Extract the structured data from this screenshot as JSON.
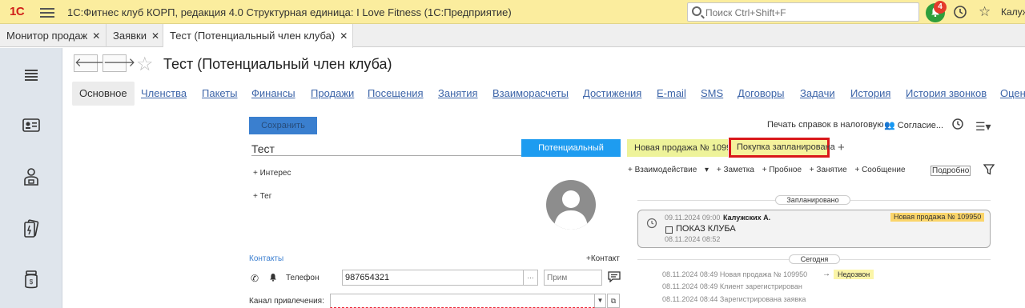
{
  "titlebar": {
    "logo": "1С",
    "title": "1С:Фитнес клуб КОРП, редакция 4.0 Структурная единица: I Love Fitness  (1С:Предприятие)",
    "search_placeholder": "Поиск Ctrl+Shift+F",
    "notification_count": "4",
    "user": "Калуж"
  },
  "tabs": [
    {
      "label": "Монитор продаж",
      "close": "✕"
    },
    {
      "label": "Заявки",
      "close": "✕"
    },
    {
      "label": "Тест (Потенциальный член клуба)",
      "close": "✕"
    }
  ],
  "header": {
    "back": "🡐",
    "forward": "🡒",
    "title": "Тест (Потенциальный член клуба)"
  },
  "sections": [
    "Основное",
    "Членства",
    "Пакеты",
    "Финансы",
    "Продажи",
    "Посещения",
    "Занятия",
    "Взаиморасчеты",
    "Достижения",
    "E-mail",
    "SMS",
    "Договоры",
    "Задачи",
    "История",
    "История звонков",
    "Оцен"
  ],
  "form": {
    "save": "Сохранить",
    "print": "Печать справок в налоговую",
    "consents": "Согласие...",
    "name": "Тест",
    "status": "Потенциальный",
    "sale_badge": "Новая продажа № 109950",
    "planned_badge": "Покупка запланирована",
    "add_tab": "+",
    "interest": "+ Интерес",
    "tag": "+ Тег",
    "contacts": "Контакты",
    "add_contact": "+Контакт",
    "phone_label": "Телефон",
    "phone_value": "987654321",
    "phone_dots": "...",
    "note_placeholder": "Прим",
    "channel_label": "Канал привлечения:"
  },
  "feed": {
    "actions": [
      "+ Взаимодействие",
      "+ Заметка",
      "+ Пробное",
      "+ Занятие",
      "+ Сообщение"
    ],
    "details": "Подробно",
    "planned_header": "Запланировано",
    "event": {
      "date": "09.11.2024 09:00",
      "author": "Калужских А.",
      "badge": "Новая продажа № 109950",
      "title": "ПОКАЗ КЛУБА",
      "created": "08.11.2024 08:52"
    },
    "today_header": "Сегодня",
    "log": [
      "08.11.2024 08:49 Новая продажа № 109950",
      "08.11.2024 08:49 Клиент зарегистрирован",
      "08.11.2024 08:44 Зарегистрирована заявка"
    ],
    "log_arrow": "→",
    "log_badge": "Недозвон"
  },
  "colors": {
    "titlebar": "#fbed9e",
    "accent_blue": "#1e9cf0",
    "link": "#3c64a8",
    "highlight_border": "#d9181a"
  }
}
